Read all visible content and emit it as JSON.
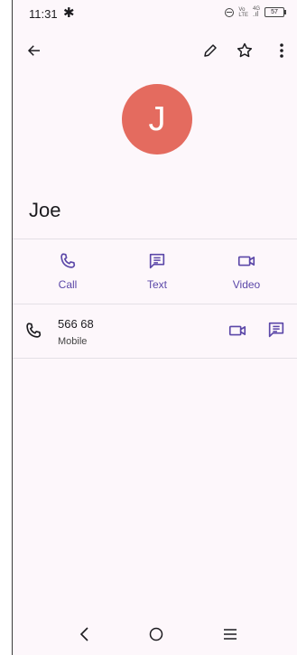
{
  "status_bar": {
    "time": "11:31",
    "network_top": "Vo",
    "network_bottom": "LTE",
    "signal_label": "4G",
    "battery": "57"
  },
  "toolbar": {
    "back_icon": "arrow-left-icon",
    "edit_icon": "pencil-icon",
    "star_icon": "star-outline-icon",
    "more_icon": "more-vert-icon"
  },
  "contact": {
    "initial": "J",
    "avatar_color": "#e46b5f",
    "name": "Joe"
  },
  "actions": [
    {
      "label": "Call",
      "icon": "phone-icon"
    },
    {
      "label": "Text",
      "icon": "message-icon"
    },
    {
      "label": "Video",
      "icon": "video-icon"
    }
  ],
  "phone_entry": {
    "number": "566 68",
    "type": "Mobile"
  },
  "colors": {
    "accent": "#5b47a8",
    "background": "#fdf7fb"
  }
}
